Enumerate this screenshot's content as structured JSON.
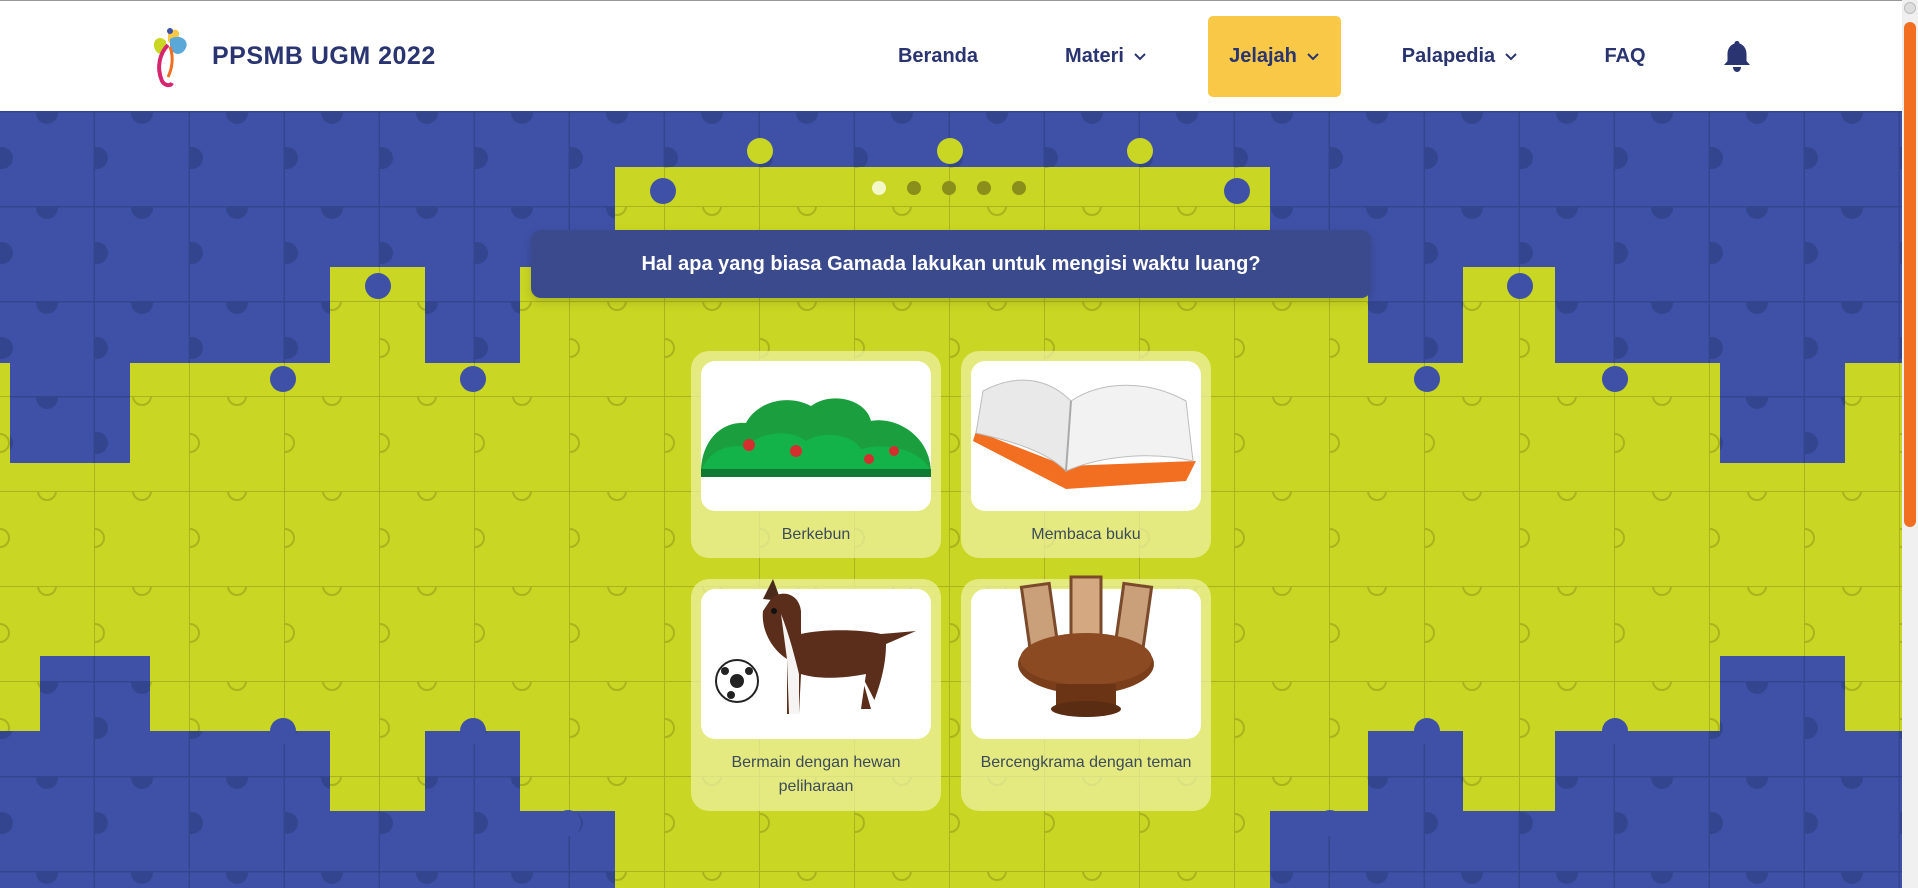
{
  "brand": {
    "name": "PPSMB UGM 2022",
    "logo_icon": "ppsmb-flower-logo"
  },
  "nav": {
    "items": [
      {
        "label": "Beranda",
        "has_dropdown": false,
        "active": false
      },
      {
        "label": "Materi",
        "has_dropdown": true,
        "active": false
      },
      {
        "label": "Jelajah",
        "has_dropdown": true,
        "active": true
      },
      {
        "label": "Palapedia",
        "has_dropdown": true,
        "active": false
      },
      {
        "label": "FAQ",
        "has_dropdown": false,
        "active": false
      }
    ],
    "notification_icon": "bell-icon"
  },
  "carousel": {
    "slide_count": 5,
    "active_index": 0
  },
  "quiz": {
    "question": "Hal apa yang biasa Gamada lakukan untuk mengisi waktu luang?",
    "options": [
      {
        "label": "Berkebun",
        "image_icon": "garden-bushes-illustration"
      },
      {
        "label": "Membaca buku",
        "image_icon": "open-book-illustration"
      },
      {
        "label": "Bermain dengan hewan peliharaan",
        "image_icon": "dog-with-ball-illustration"
      },
      {
        "label": "Bercengkrama dengan teman",
        "image_icon": "round-table-chairs-illustration"
      }
    ]
  },
  "colors": {
    "nav_text": "#2a3470",
    "nav_active_bg": "#f9c846",
    "hero_yellow": "#c9d623",
    "puzzle_blue": "#3f51a7",
    "question_bg": "#3a4a8d",
    "scrollbar_thumb": "#f26e21"
  }
}
